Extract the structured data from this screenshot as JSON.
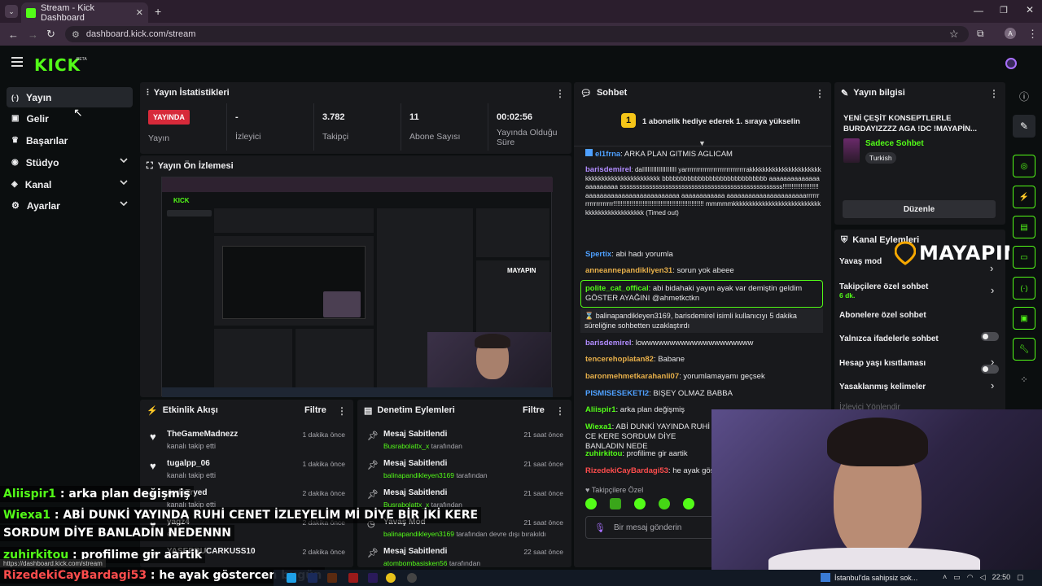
{
  "browser": {
    "tab_title": "Stream - Kick Dashboard",
    "url": "dashboard.kick.com/stream",
    "profile": "A"
  },
  "brand": {
    "logo": "KICK",
    "beta": "BETA",
    "accent": "#53fc18"
  },
  "sidebar": {
    "items": [
      {
        "label": "Yayın",
        "icon": "broadcast-icon"
      },
      {
        "label": "Gelir",
        "icon": "wallet-icon"
      },
      {
        "label": "Başarılar",
        "icon": "trophy-icon"
      },
      {
        "label": "Stüdyo",
        "icon": "studio-icon"
      },
      {
        "label": "Kanal",
        "icon": "channel-icon"
      },
      {
        "label": "Ayarlar",
        "icon": "gear-icon"
      }
    ]
  },
  "stats": {
    "title": "Yayın İstatistikleri",
    "live_badge": "YAYINDA",
    "live_label": "Yayın",
    "items": [
      {
        "value": "-",
        "label": "İzleyici"
      },
      {
        "value": "3.782",
        "label": "Takipçi"
      },
      {
        "value": "11",
        "label": "Abone Sayısı"
      },
      {
        "value": "00:02:56",
        "label": "Yayında Olduğu Süre"
      }
    ]
  },
  "preview": {
    "title": "Yayın Ön İzlemesi"
  },
  "activity": {
    "title": "Etkinlik Akışı",
    "filter": "Filtre",
    "rows": [
      {
        "name": "TheGameMadnezz",
        "action": "kanalı takip etti",
        "time": "1 dakika önce"
      },
      {
        "name": "tugalpp_06",
        "action": "kanalı takip etti",
        "time": "1 dakika önce"
      },
      {
        "name": "ArdaTryed",
        "action": "kanalı takip etti",
        "time": "2 dakika önce"
      },
      {
        "name": "yagz4",
        "action": "etti",
        "time": "2 dakika önce"
      },
      {
        "name": "YASERRUCARKUSS10",
        "action": "",
        "time": "2 dakika önce"
      }
    ]
  },
  "moderation": {
    "title": "Denetim Eylemleri",
    "filter": "Filtre",
    "rows": [
      {
        "action": "Mesaj Sabitlendi",
        "by": "Busrabolattx_x",
        "suffix": "tarafından",
        "time": "21 saat önce"
      },
      {
        "action": "Mesaj Sabitlendi",
        "by": "balinapandikleyen3169",
        "suffix": "tarafından",
        "time": "21 saat önce"
      },
      {
        "action": "Mesaj Sabitlendi",
        "by": "Busrabolattx_x",
        "suffix": "tarafından",
        "time": "21 saat önce"
      },
      {
        "action": "Yavaş Mod",
        "by": "balinapandikleyen3169",
        "suffix": "tarafından devre dışı bırakıldı",
        "time": "21 saat önce"
      },
      {
        "action": "Mesaj Sabitlendi",
        "by": "atombombasisken56",
        "suffix": "tarafından",
        "time": "22 saat önce"
      }
    ]
  },
  "chat": {
    "title": "Sohbet",
    "pinned": "1 abonelik hediye ederek 1. sıraya yükselin",
    "followers_only": "Takipçilere Özel",
    "input_placeholder": "Bir mesaj gönderin",
    "messages": [
      {
        "user": "el1frna",
        "color": "#4ea0ff",
        "text": "ARKA PLAN GITMIS AGLICAM"
      },
      {
        "user": "barisdemirel",
        "color": "#b18cff",
        "text": "daIIIIIIIIIIIIIIIIIII yarrrrrrrrrrrrrrrrrrrrrrrrrrrrakkkkkkkkkkkkkkkkkkkkkkkkkkkkkkkkkkkkkkkkkkkkk bbbbbbbbbbbbbbbbbbbbbbbbbbbbb aaaaaaaaaaaaaaaaaaaaaaa ssssssssssssssssssssssssssssssssssssssssssssssssss!!!!!!!!!!!!!!!!!!!!aaaaaaaaaaaaaaaaaaaaaaaaaa aaaaaaaaaaaa aaaaaaaaaaaaaaaaaaaaaarrrrrrrrrrrrrrrrrrr!!!!!!!!!!!!!!!!!!!!!!!!!!!!!!!!!!!!!!!!!!!!!!!!!! mmmmmkkkkkkkkkkkkkkkkkkkkkkkkkkkkkkkkkkkkkkkkkkkkk (Timed out)"
      },
      {
        "user": "Spertix",
        "color": "#4ea0ff",
        "text": "abi hadı yorumla"
      },
      {
        "user": "anneannepandikliyen31",
        "color": "#e8b04a",
        "text": "sorun yok abeee"
      },
      {
        "user": "polite_cat_offical",
        "color": "#53fc18",
        "text": "abi bidahaki yayın ayak var demiştin geldim GÖSTER AYAĞINI @ahmetkctkn"
      },
      {
        "user": "system",
        "color": "#e6e6e8",
        "text": "balinapandikleyen3169, barisdemirel isimli kullanıcıyı 5 dakika süreliğine sohbetten uzaklaştırdı"
      },
      {
        "user": "barisdemirel",
        "color": "#b18cff",
        "text": "lowwwwwwwwwwwwwwwwwwww"
      },
      {
        "user": "tencerehoplatan82",
        "color": "#e8b04a",
        "text": "Babane"
      },
      {
        "user": "baronmehmetkarahanli07",
        "color": "#e8b04a",
        "text": "yorumlamayamı geçsek"
      },
      {
        "user": "PISMISESEKETI2",
        "color": "#4ea0ff",
        "text": "BIŞEY OLMAZ BABBA"
      },
      {
        "user": "Aliispir1",
        "color": "#53fc18",
        "text": "arka plan değişmiş"
      },
      {
        "user": "Wiexa1",
        "color": "#53fc18",
        "text": "ABİ DUNKİ YAYINDA RUHİ CE KERE SORDUM DİYE BANLADIN NEDE"
      },
      {
        "user": "zuhirkitou",
        "color": "#53fc18",
        "text": "profilime gir aartik"
      },
      {
        "user": "RizedekiCayBardagi53",
        "color": "#ff4d4d",
        "text": "he ayak göste"
      }
    ]
  },
  "stream_info": {
    "title": "Yayın bilgisi",
    "stream_title": "YENİ ÇEŞİT KONSEPTLERLE BURDAYIZZZZ AGA !DC !MAYAPİN...",
    "category": "Sadece Sohbet",
    "tag": "Turkish",
    "edit": "Düzenle"
  },
  "channel_actions": {
    "title": "Kanal Eylemleri",
    "overlay_logo": "MAYAPIN",
    "items": [
      {
        "label": "Yavaş mod",
        "type": "chevron"
      },
      {
        "label": "Takipçilere özel sohbet",
        "sub": "6 dk.",
        "type": "chevron"
      },
      {
        "label": "Abonelere özel sohbet",
        "type": "switch"
      },
      {
        "label": "Yalnızca ifadelerle sohbet",
        "type": "switch"
      },
      {
        "label": "Hesap yaşı kısıtlaması",
        "type": "chevron"
      },
      {
        "label": "Yasaklanmış kelimeler",
        "type": "chevron"
      },
      {
        "label": "İzleyici Yönlendir",
        "type": "none"
      }
    ]
  },
  "overlay_chat": [
    {
      "user": "Aliispir1",
      "color": "#53fc18",
      "text": "arka plan değişmiş"
    },
    {
      "user": "Wiexa1",
      "color": "#53fc18",
      "text": "ABİ DUNKİ YAYINDA RUHİ CENET İZLEYELİM Mİ DİYE BİR İKİ KERE"
    },
    {
      "user": "",
      "color": "#fff",
      "text": "SORDUM DİYE BANLADIN NEDENNN"
    },
    {
      "user": "zuhirkitou",
      "color": "#53fc18",
      "text": "profilime gir aartik"
    },
    {
      "user": "RizedekiCayBardagi53",
      "color": "#ff4d4d",
      "text": "he ayak göstercen bugün"
    }
  ],
  "status_url": "https://dashboard.kick.com/stream",
  "taskbar": {
    "weather": "İstanbul'da sahipsiz sok...",
    "time": "22:50"
  }
}
